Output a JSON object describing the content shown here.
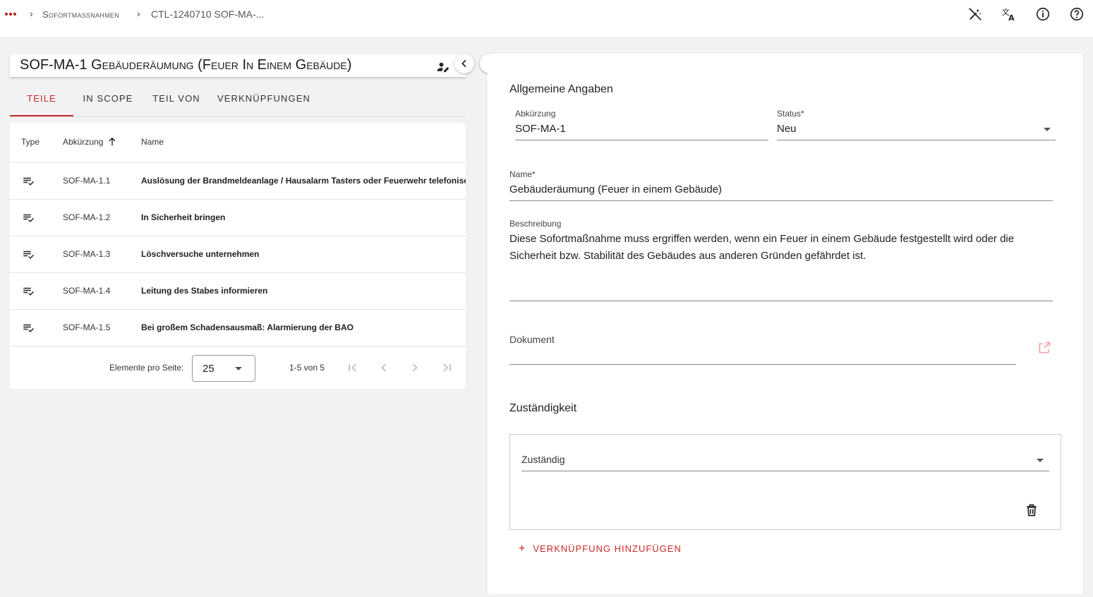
{
  "breadcrumb": {
    "items": [
      {
        "label": "Sofortmaßnahmen"
      },
      {
        "label": "CTL-1240710 SOF-MA-..."
      }
    ]
  },
  "topbar": {
    "icons": [
      "auto-fix-off-icon",
      "translate-icon",
      "info-icon",
      "help-icon"
    ]
  },
  "header": {
    "title": "SOF-MA-1 Gebäuderäumung (Feuer In Einem Gebäude)"
  },
  "tabs": [
    {
      "label": "Teile",
      "active": true
    },
    {
      "label": "In Scope",
      "active": false
    },
    {
      "label": "Teil von",
      "active": false
    },
    {
      "label": "Verknüpfungen",
      "active": false
    }
  ],
  "table": {
    "columns": {
      "type": "Type",
      "abbr": "Abkürzung",
      "name": "Name"
    },
    "sort": {
      "column": "abbr",
      "direction": "asc"
    },
    "rows": [
      {
        "abbr": "SOF-MA-1.1",
        "name": "Auslösung der Brandmeldeanlage / Hausalarm Tasters oder Feuerwehr telefonisch alarmieren"
      },
      {
        "abbr": "SOF-MA-1.2",
        "name": "In Sicherheit bringen"
      },
      {
        "abbr": "SOF-MA-1.3",
        "name": "Löschversuche unternehmen"
      },
      {
        "abbr": "SOF-MA-1.4",
        "name": "Leitung des Stabes informieren"
      },
      {
        "abbr": "SOF-MA-1.5",
        "name": "Bei großem Schadensausmaß: Alarmierung der BAO"
      }
    ],
    "pager": {
      "label": "Elemente pro Seite:",
      "page_size": "25",
      "range": "1-5 von 5"
    }
  },
  "detail": {
    "general_title": "Allgemeine Angaben",
    "abbreviation": {
      "label": "Abkürzung",
      "value": "SOF-MA-1"
    },
    "status": {
      "label": "Status*",
      "value": "Neu"
    },
    "name": {
      "label": "Name*",
      "value": "Gebäuderäumung (Feuer in einem Gebäude)"
    },
    "description": {
      "label": "Beschreibung",
      "value": "Diese Sofortmaßnahme muss ergriffen werden, wenn ein Feuer in einem Gebäude festgestellt wird oder die Sicherheit bzw. Stabilität des Gebäudes aus anderen Gründen gefährdet ist."
    },
    "document": {
      "label": "Dokument",
      "value": ""
    },
    "responsibility_title": "Zuständigkeit",
    "responsible": {
      "label": "Zuständig"
    },
    "add_link_label": "Verknüpfung hinzufügen"
  },
  "colors": {
    "accent": "#c62828",
    "background": "#f2f2f2"
  }
}
